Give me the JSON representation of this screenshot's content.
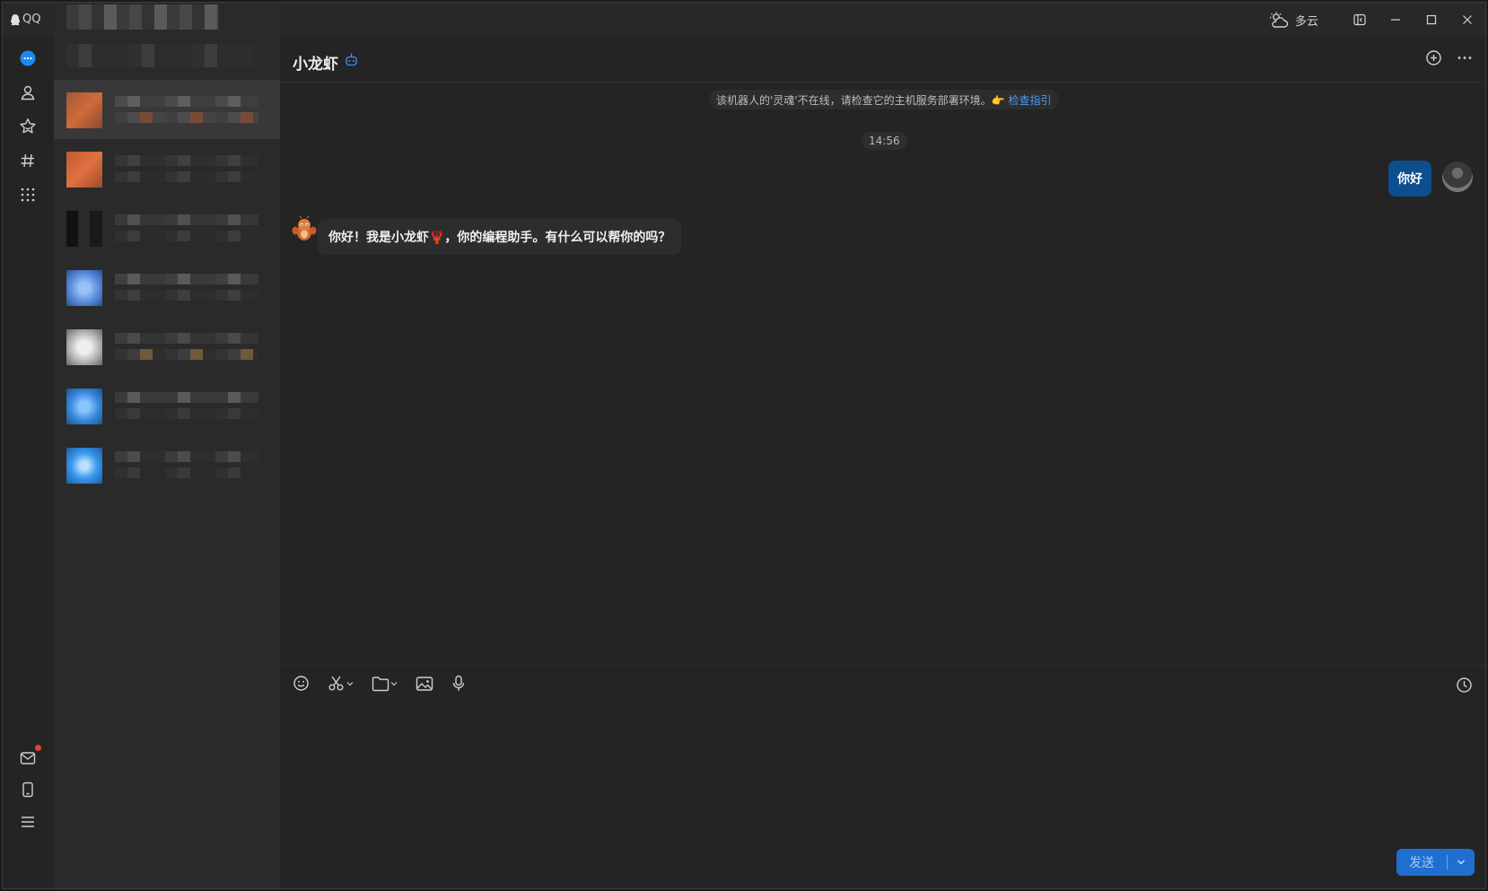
{
  "app": {
    "name": "QQ"
  },
  "weather": {
    "label": "多云"
  },
  "rail": {
    "top": [
      "messages-icon",
      "contacts-icon",
      "favorites-icon",
      "channels-icon",
      "apps-grid-icon"
    ],
    "bottom": [
      "mail-icon",
      "phone-icon",
      "menu-icon"
    ]
  },
  "chat": {
    "title": "小龙虾",
    "notice": {
      "text": "该机器人的'灵魂'不在线，请检查它的主机服务部署环境。👉",
      "link": "检查指引"
    },
    "time": "14:56",
    "messages": [
      {
        "from": "me",
        "text": "你好"
      },
      {
        "from": "bot",
        "text": "你好！我是小龙虾🦞，你的编程助手。有什么可以帮你的吗？"
      }
    ]
  },
  "composer": {
    "send_label": "发送"
  },
  "colors": {
    "accent": "#1f6fd1",
    "bubble_out": "#0d4e8f",
    "link": "#4a9bf5",
    "badge": "#e8403a"
  }
}
